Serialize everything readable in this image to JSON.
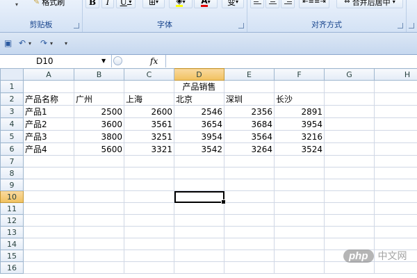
{
  "ribbon": {
    "clipboard": {
      "label": "剪贴板",
      "format_painter": "格式刷"
    },
    "font": {
      "label": "字体",
      "bold": "B",
      "italic": "I",
      "underline": "U",
      "font_color": "A",
      "phonetic": "变"
    },
    "alignment": {
      "label": "对齐方式",
      "merge_center": "合并后居中"
    }
  },
  "formula_bar": {
    "name_box": "D10",
    "fx_label": "fx",
    "formula": ""
  },
  "sheet": {
    "columns": [
      "A",
      "B",
      "C",
      "D",
      "E",
      "F",
      "G",
      "H"
    ],
    "selected_column": "D",
    "selected_row": 10,
    "rows": [
      {
        "row": "1",
        "cells": [
          "",
          "",
          "",
          "产品销售",
          "",
          "",
          "",
          ""
        ]
      },
      {
        "row": "2",
        "cells": [
          "产品名称",
          "广州",
          "上海",
          "北京",
          "深圳",
          "长沙",
          "",
          ""
        ]
      },
      {
        "row": "3",
        "cells": [
          "产品1",
          "2500",
          "2600",
          "2546",
          "2356",
          "2891",
          "",
          ""
        ]
      },
      {
        "row": "4",
        "cells": [
          "产品2",
          "3600",
          "3561",
          "3654",
          "3684",
          "3954",
          "",
          ""
        ]
      },
      {
        "row": "5",
        "cells": [
          "产品3",
          "3800",
          "3251",
          "3954",
          "3564",
          "3216",
          "",
          ""
        ]
      },
      {
        "row": "6",
        "cells": [
          "产品4",
          "5600",
          "3321",
          "3542",
          "3264",
          "3524",
          "",
          ""
        ]
      },
      {
        "row": "7",
        "cells": [
          "",
          "",
          "",
          "",
          "",
          "",
          "",
          ""
        ]
      },
      {
        "row": "8",
        "cells": [
          "",
          "",
          "",
          "",
          "",
          "",
          "",
          ""
        ]
      },
      {
        "row": "9",
        "cells": [
          "",
          "",
          "",
          "",
          "",
          "",
          "",
          ""
        ]
      },
      {
        "row": "10",
        "cells": [
          "",
          "",
          "",
          "",
          "",
          "",
          "",
          ""
        ]
      },
      {
        "row": "11",
        "cells": [
          "",
          "",
          "",
          "",
          "",
          "",
          "",
          ""
        ]
      },
      {
        "row": "12",
        "cells": [
          "",
          "",
          "",
          "",
          "",
          "",
          "",
          ""
        ]
      },
      {
        "row": "13",
        "cells": [
          "",
          "",
          "",
          "",
          "",
          "",
          "",
          ""
        ]
      },
      {
        "row": "14",
        "cells": [
          "",
          "",
          "",
          "",
          "",
          "",
          "",
          ""
        ]
      },
      {
        "row": "15",
        "cells": [
          "",
          "",
          "",
          "",
          "",
          "",
          "",
          ""
        ]
      },
      {
        "row": "16",
        "cells": [
          "",
          "",
          "",
          "",
          "",
          "",
          "",
          ""
        ]
      }
    ]
  },
  "watermark": {
    "logo": "php",
    "site": "中文网"
  },
  "colors": {
    "header_selected": "#f1c15f",
    "ribbon_label": "#15428b",
    "grid_line": "#d0d7e5"
  }
}
